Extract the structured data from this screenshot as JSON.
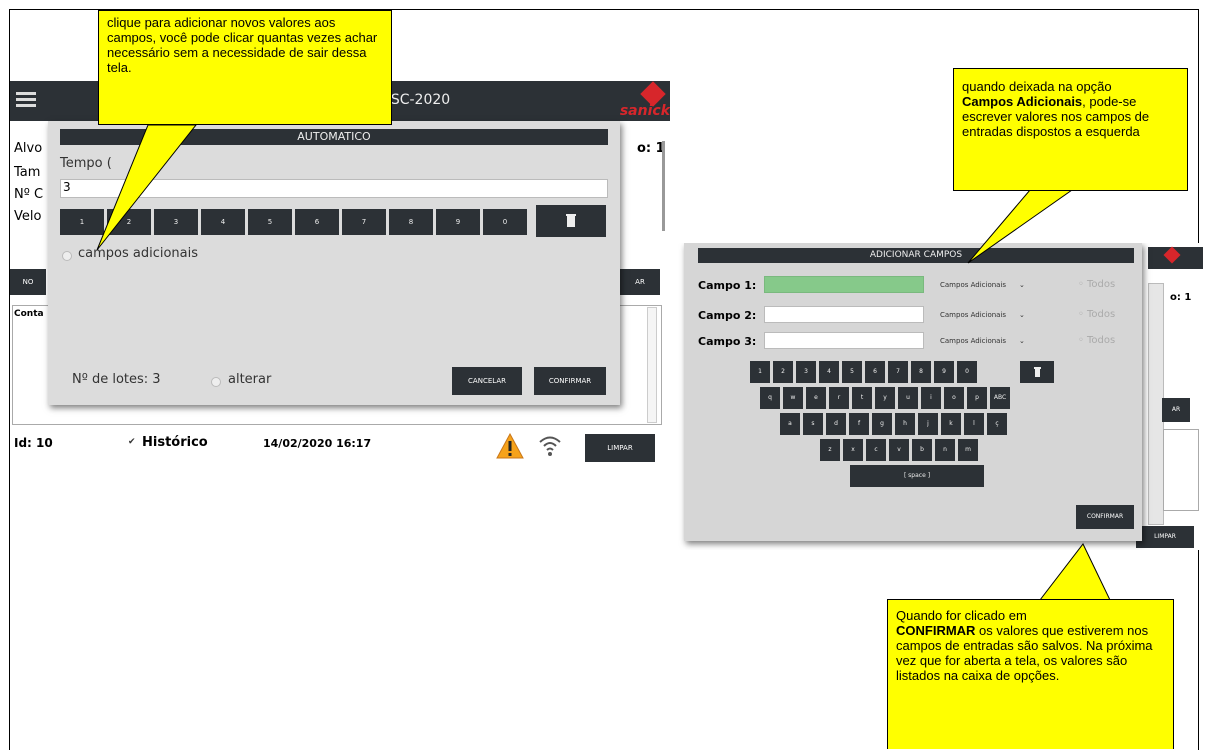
{
  "left": {
    "app_title": "ESC-2020",
    "logo_text": "sanick",
    "bg_labels": [
      "Alvo",
      "Tam",
      "Nº C",
      "Velo"
    ],
    "bg_right": "o: 1",
    "bg_button_left": "NO",
    "bg_button_right": "AR",
    "bg_cont": "Conta",
    "dialog": {
      "title": "AUTOMATICO",
      "field_label": "Tempo (",
      "field_value": "3",
      "keys": [
        "1",
        "2",
        "3",
        "4",
        "5",
        "6",
        "7",
        "8",
        "9",
        "0"
      ],
      "checkbox_label": "campos adicionais",
      "lotes": "Nº de lotes: 3",
      "alterar": "alterar",
      "cancel": "CANCELAR",
      "confirm": "CONFIRMAR"
    },
    "status": {
      "id": "Id: 10",
      "historico": "Histórico",
      "datetime": "14/02/2020 16:17",
      "limpar": "LIMPAR"
    }
  },
  "right": {
    "dialog": {
      "title": "ADICIONAR CAMPOS",
      "fields": [
        {
          "label": "Campo 1:",
          "option": "Campos Adicionais",
          "todos": "Todos"
        },
        {
          "label": "Campo 2:",
          "option": "Campos Adicionais",
          "todos": "Todos"
        },
        {
          "label": "Campo 3:",
          "option": "Campos Adicionais",
          "todos": "Todos"
        }
      ],
      "row1": [
        "1",
        "2",
        "3",
        "4",
        "5",
        "6",
        "7",
        "8",
        "9",
        "0"
      ],
      "row2": [
        "q",
        "w",
        "e",
        "r",
        "t",
        "y",
        "u",
        "i",
        "o",
        "p",
        "ABC"
      ],
      "row3": [
        "a",
        "s",
        "d",
        "f",
        "g",
        "h",
        "j",
        "k",
        "l",
        "ç"
      ],
      "row4": [
        "z",
        "x",
        "c",
        "v",
        "b",
        "n",
        "m"
      ],
      "space": "[ space ]",
      "confirm": "CONFIRMAR"
    },
    "bg_right": "o: 1",
    "bg_ar": "AR",
    "limpar": "LIMPAR"
  },
  "callouts": {
    "top_left": "clique para adicionar novos valores aos campos, você pode clicar quantas vezes achar necessário sem a necessidade de sair dessa tela.",
    "top_right_1": "quando deixada na opção",
    "top_right_bold": "Campos Adicionais",
    "top_right_2": ", pode-se escrever valores nos campos de entradas dispostos a esquerda",
    "bottom_1": "Quando for clicado em",
    "bottom_bold": "CONFIRMAR",
    "bottom_2": " os valores que estiverem nos campos de entradas são salvos. Na próxima vez que for aberta a tela, os valores são listados na caixa de opções."
  },
  "colors": {
    "callout": "#ffff00",
    "dark": "#2c3136",
    "green_field": "#86c98a",
    "logo_red": "#d7262b"
  }
}
